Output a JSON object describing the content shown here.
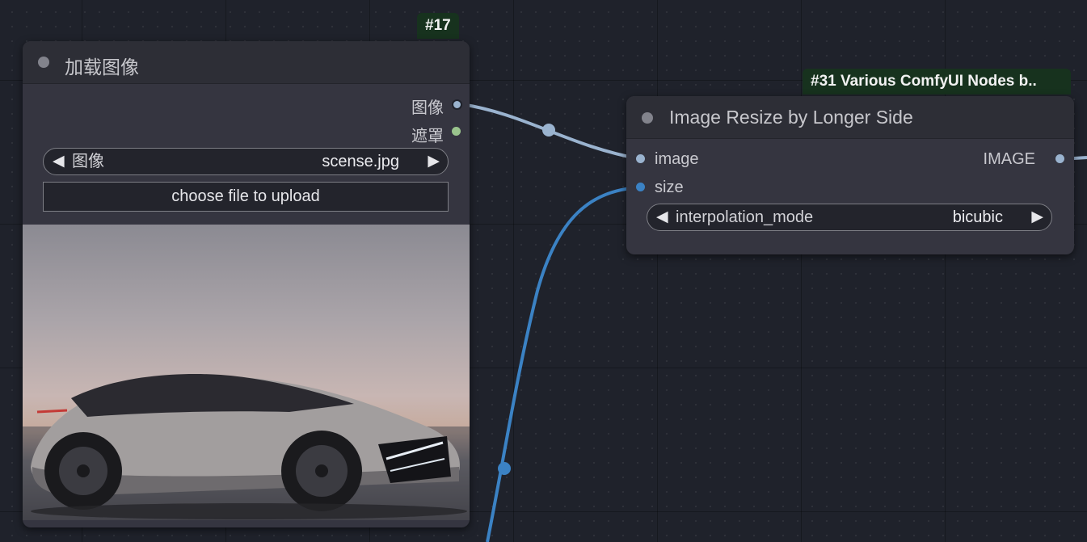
{
  "nodes": {
    "load_image": {
      "id_badge": "#17",
      "title": "加载图像",
      "outputs": [
        {
          "label": "图像",
          "color": "#9ab3cf"
        },
        {
          "label": "遮罩",
          "color": "#9ac48d"
        }
      ],
      "image_select": {
        "label": "图像",
        "value": "scense.jpg"
      },
      "upload_button": "choose file to upload"
    },
    "resize": {
      "id_badge": "#31 Various ComfyUI Nodes b..",
      "title": "Image Resize by Longer Side",
      "inputs": [
        {
          "label": "image",
          "color": "#9ab3cf"
        },
        {
          "label": "size",
          "color": "#3b82c4"
        }
      ],
      "output": {
        "label": "IMAGE",
        "color": "#9ab3cf"
      },
      "interpolation": {
        "label": "interpolation_mode",
        "value": "bicubic"
      }
    }
  },
  "icons": {
    "arrow_left": "◀",
    "arrow_right": "▶"
  },
  "colors": {
    "canvas_bg": "#1f222b",
    "node_body": "#353540",
    "node_header": "#2d2e36",
    "badge_bg": "#17321e",
    "image_link": "#9ab3cf",
    "int_link": "#3b82c4"
  }
}
